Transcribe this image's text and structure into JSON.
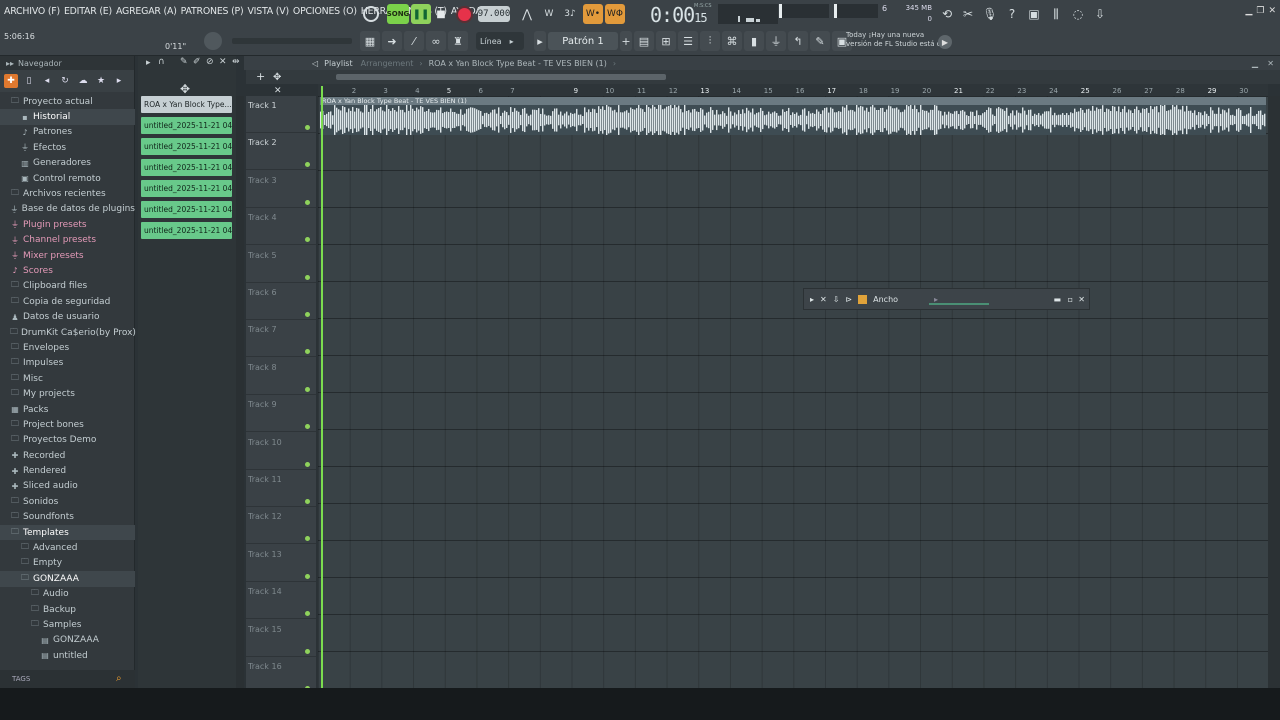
{
  "menu": [
    "ARCHIVO (F)",
    "EDITAR (E)",
    "AGREGAR (A)",
    "PATRONES (P)",
    "VISTA (V)",
    "OPCIONES (O)",
    "HERRAMIENTAS (T)",
    "AYUDA"
  ],
  "transport": {
    "song_label": "SONG",
    "tempo": "97.000",
    "time": "0:00",
    "time_small": "15",
    "time_unit": "M:S:CS"
  },
  "hints": {
    "position": "5:06:16",
    "left_time": "0'11\""
  },
  "cpu": {
    "value": "6",
    "mem": "345 MB",
    "poly": "0"
  },
  "toolbar2": {
    "snap": "Línea",
    "pattern": "Patrón 1"
  },
  "news": {
    "line1": "Today  ¡Hay una nueva",
    "line2": "versión de FL Studio está d..."
  },
  "browser": {
    "title": "Navegador",
    "items": [
      {
        "label": "Proyecto actual",
        "icon": "folder",
        "indent": 0,
        "color": "#c4ced2"
      },
      {
        "label": "Historial",
        "icon": "history",
        "indent": 1,
        "color": "#ffffff",
        "selected": true
      },
      {
        "label": "Patrones",
        "icon": "note",
        "indent": 1,
        "color": "#c4ced2"
      },
      {
        "label": "Efectos",
        "icon": "plug",
        "indent": 1,
        "color": "#c4ced2"
      },
      {
        "label": "Generadores",
        "icon": "gen",
        "indent": 1,
        "color": "#c4ced2"
      },
      {
        "label": "Control remoto",
        "icon": "remote",
        "indent": 1,
        "color": "#c4ced2"
      },
      {
        "label": "Archivos recientes",
        "icon": "folder",
        "indent": 0,
        "color": "#c4ced2"
      },
      {
        "label": "Base de datos de plugins",
        "icon": "plug",
        "indent": 0,
        "color": "#c4ced2"
      },
      {
        "label": "Plugin presets",
        "icon": "plug",
        "indent": 0,
        "color": "#e49ab8",
        "pink": true
      },
      {
        "label": "Channel presets",
        "icon": "plug",
        "indent": 0,
        "color": "#e49ab8",
        "pink": true
      },
      {
        "label": "Mixer presets",
        "icon": "plug",
        "indent": 0,
        "color": "#e49ab8",
        "pink": true
      },
      {
        "label": "Scores",
        "icon": "note",
        "indent": 0,
        "color": "#e49ab8",
        "pink": true
      },
      {
        "label": "Clipboard files",
        "icon": "folder",
        "indent": 0,
        "color": "#c4ced2"
      },
      {
        "label": "Copia de seguridad",
        "icon": "folder",
        "indent": 0,
        "color": "#c4ced2"
      },
      {
        "label": "Datos de usuario",
        "icon": "user",
        "indent": 0,
        "color": "#c4ced2"
      },
      {
        "label": "DrumKit Ca$erio(by Prox)",
        "icon": "folder",
        "indent": 0,
        "color": "#c4ced2"
      },
      {
        "label": "Envelopes",
        "icon": "folder",
        "indent": 0,
        "color": "#c4ced2"
      },
      {
        "label": "Impulses",
        "icon": "folder",
        "indent": 0,
        "color": "#c4ced2"
      },
      {
        "label": "Misc",
        "icon": "folder",
        "indent": 0,
        "color": "#c4ced2"
      },
      {
        "label": "My projects",
        "icon": "folder",
        "indent": 0,
        "color": "#c4ced2"
      },
      {
        "label": "Packs",
        "icon": "packs",
        "indent": 0,
        "color": "#c4ced2"
      },
      {
        "label": "Project bones",
        "icon": "folder",
        "indent": 0,
        "color": "#c4ced2"
      },
      {
        "label": "Proyectos Demo",
        "icon": "folder",
        "indent": 0,
        "color": "#c4ced2"
      },
      {
        "label": "Recorded",
        "icon": "plus",
        "indent": 0,
        "color": "#c4ced2"
      },
      {
        "label": "Rendered",
        "icon": "plus",
        "indent": 0,
        "color": "#c4ced2"
      },
      {
        "label": "Sliced audio",
        "icon": "plus",
        "indent": 0,
        "color": "#c4ced2"
      },
      {
        "label": "Sonidos",
        "icon": "folder",
        "indent": 0,
        "color": "#c4ced2"
      },
      {
        "label": "Soundfonts",
        "icon": "folder",
        "indent": 0,
        "color": "#c4ced2"
      },
      {
        "label": "Templates",
        "icon": "folder",
        "indent": 0,
        "color": "#ffffff",
        "selected": true
      },
      {
        "label": "Advanced",
        "icon": "folder",
        "indent": 1,
        "color": "#c4ced2"
      },
      {
        "label": "Empty",
        "icon": "folder",
        "indent": 1,
        "color": "#c4ced2"
      },
      {
        "label": "GONZAAA",
        "icon": "folder",
        "indent": 1,
        "color": "#ffffff",
        "selected": true
      },
      {
        "label": "Audio",
        "icon": "folder",
        "indent": 2,
        "color": "#c4ced2"
      },
      {
        "label": "Backup",
        "icon": "folder",
        "indent": 2,
        "color": "#c4ced2"
      },
      {
        "label": "Samples",
        "icon": "folder",
        "indent": 2,
        "color": "#c4ced2"
      },
      {
        "label": "GONZAAA",
        "icon": "file",
        "indent": 3,
        "color": "#c4ced2"
      },
      {
        "label": "untitled",
        "icon": "file",
        "indent": 3,
        "color": "#c4ced2"
      }
    ],
    "tags": "TAGS"
  },
  "clips": [
    "ROA x Yan Block Type...",
    "untitled_2025-11-21 04-...",
    "untitled_2025-11-21 04-...",
    "untitled_2025-11-21 04-...",
    "untitled_2025-11-21 04-...",
    "untitled_2025-11-21 04-...",
    "untitled_2025-11-21 04-..."
  ],
  "playlist": {
    "title": "Playlist",
    "arrangement": "Arrangement",
    "project": "ROA x Yan Block Type Beat - TE VES BIEN (1)",
    "clip_label": "ROA x Yan Block Type Beat - TE VES BIEN (1)"
  },
  "tracks": [
    "Track 1",
    "Track 2",
    "Track 3",
    "Track 4",
    "Track 5",
    "Track 6",
    "Track 7",
    "Track 8",
    "Track 9",
    "Track 10",
    "Track 11",
    "Track 12",
    "Track 13",
    "Track 14",
    "Track 15",
    "Track 16"
  ],
  "ruler": [
    "2",
    "3",
    "4",
    "5",
    "6",
    "7",
    "9",
    "10",
    "11",
    "12",
    "13",
    "14",
    "15",
    "16",
    "17",
    "18",
    "19",
    "20",
    "21",
    "22",
    "23",
    "24",
    "25",
    "26",
    "27",
    "28",
    "29",
    "30"
  ],
  "float_window": {
    "label": "Ancho"
  }
}
